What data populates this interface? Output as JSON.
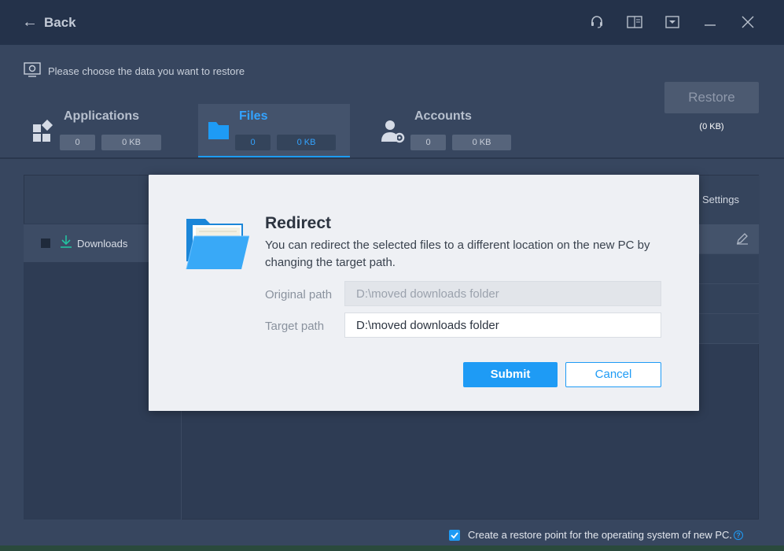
{
  "titlebar": {
    "back_label": "Back",
    "icons": [
      "headset-icon",
      "book-icon",
      "dropdown-box-icon",
      "minimize-icon",
      "close-icon"
    ]
  },
  "hint": "Please choose the data you want to restore",
  "tabs": [
    {
      "label": "Applications",
      "count": "0",
      "size": "0 KB",
      "icon": "apps-icon",
      "active": false
    },
    {
      "label": "Files",
      "count": "0",
      "size": "0 KB",
      "icon": "folder-icon",
      "active": true
    },
    {
      "label": "Accounts",
      "count": "0",
      "size": "0 KB",
      "icon": "user-gear-icon",
      "active": false
    }
  ],
  "restore": {
    "label": "Restore",
    "size": "(0 KB)"
  },
  "panel": {
    "settings_label": "Settings",
    "folder_item": "Downloads"
  },
  "modal": {
    "title": "Redirect",
    "description": "You can redirect the selected files to a different location on the new PC by changing the target path.",
    "original_label": "Original path",
    "original_value": "D:\\moved downloads folder",
    "target_label": "Target path",
    "target_value": "D:\\moved downloads folder",
    "submit_label": "Submit",
    "cancel_label": "Cancel"
  },
  "bottom": {
    "restore_point_label": "Create a restore point for the operating system of new PC.",
    "help_glyph": "?"
  },
  "colors": {
    "accent": "#1e9bf5",
    "background": "#37465f",
    "modal": "#eef0f4"
  }
}
